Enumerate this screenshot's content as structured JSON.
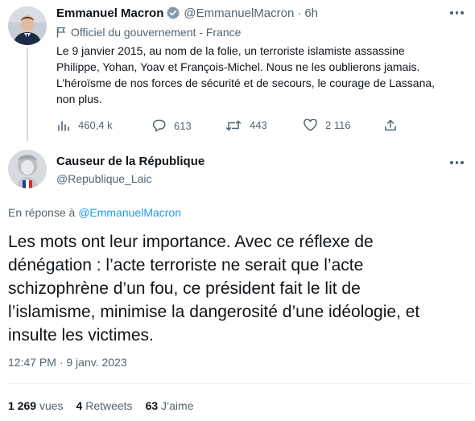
{
  "parent_tweet": {
    "author_name": "Emmanuel Macron",
    "handle": "@EmmanuelMacron",
    "separator": "·",
    "time": "6h",
    "label": "Officiel du gouvernement - France",
    "text_lines": [
      "Le 9 janvier 2015, au nom de la folie, un terroriste islamiste assassine",
      "Philippe, Yohan, Yoav et François-Michel. Nous ne les oublierons jamais.",
      "L’héroïsme de nos forces de sécurité et de secours, le courage de Lassana,",
      "non plus."
    ],
    "stats": {
      "views": "460,4 k",
      "replies": "613",
      "retweets": "443",
      "likes": "2 116"
    },
    "icons": {
      "verified": "verified-badge-icon",
      "label": "flag-icon",
      "views": "bar-chart-icon",
      "reply": "speech-bubble-icon",
      "retweet": "retweet-icon",
      "like": "heart-icon",
      "share": "share-icon"
    }
  },
  "main_tweet": {
    "author_name": "Causeur de la République",
    "handle": "@Republique_Laic",
    "reply_prefix": "En réponse à",
    "reply_handle": "@EmmanuelMacron",
    "text_lines": [
      "Les mots ont leur importance. Avec ce réflexe de",
      "dénégation : l’acte terroriste ne serait que l’acte",
      "schizophrène d’un fou, ce président fait le lit de",
      "l’islamisme, minimise la dangerosité d’une idéologie, et",
      "insulte les victimes."
    ],
    "timestamp": "12:47 PM · 9 janv. 2023",
    "stats": [
      {
        "count": "1 269",
        "label": "vues"
      },
      {
        "count": "4",
        "label": "Retweets"
      },
      {
        "count": "63",
        "label": "J’aime"
      }
    ]
  },
  "colors": {
    "text": "#0f1419",
    "secondary": "#536471",
    "link": "#1d9bf0",
    "verified": "#829aab",
    "thread_line": "#cfd9de",
    "divider": "#eff3f4"
  }
}
